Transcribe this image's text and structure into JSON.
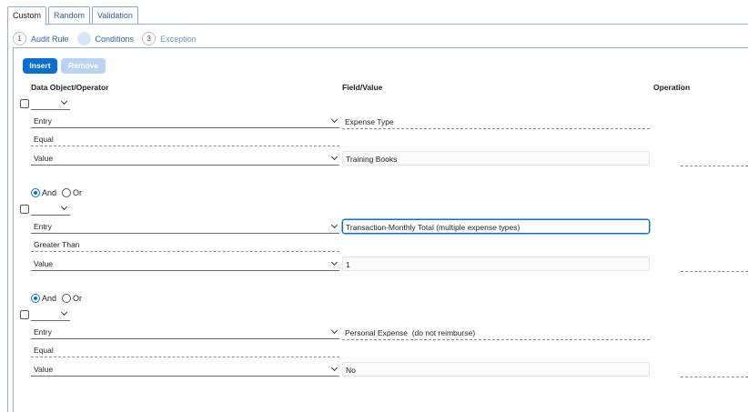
{
  "tabs": [
    {
      "label": "Custom"
    },
    {
      "label": "Random"
    },
    {
      "label": "Validation"
    }
  ],
  "steps": [
    {
      "number": "1",
      "label": "Audit Rule"
    },
    {
      "number": "2",
      "label": "Conditions"
    },
    {
      "number": "3",
      "label": "Exception"
    }
  ],
  "buttons": {
    "insert": "Insert",
    "remove": "Remove"
  },
  "columns": {
    "data_object_operator": "Data Object/Operator",
    "field_value": "Field/Value",
    "operation": "Operation"
  },
  "conditions": [
    {
      "left_object": "Entry",
      "left_field": "Expense Type",
      "operator": "Equal",
      "right_object": "Value",
      "right_value": "Training Books"
    },
    {
      "connector": {
        "and": "And",
        "or": "Or",
        "selected": "And"
      },
      "left_object": "Entry",
      "left_field": "Transaction-Monthly Total (multiple expense types)",
      "operator": "Greater Than",
      "right_object": "Value",
      "right_value": "1"
    },
    {
      "connector": {
        "and": "And",
        "or": "Or",
        "selected": "And"
      },
      "left_object": "Entry",
      "left_field": "Personal Expense  (do not reimburse)",
      "operator": "Equal",
      "right_object": "Value",
      "right_value": "No"
    }
  ],
  "colors": {
    "accent": "#0a6ed1",
    "disabled_button": "#b8d4f2",
    "link": "#2b64b8"
  }
}
